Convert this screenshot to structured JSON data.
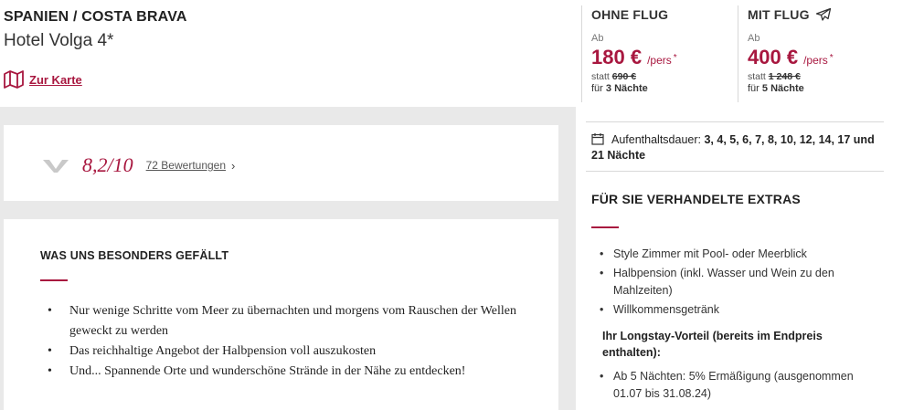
{
  "header": {
    "destination": "SPANIEN / COSTA BRAVA",
    "hotel_name": "Hotel Volga 4*",
    "map_link_label": "Zur Karte"
  },
  "rating": {
    "score": "8,2/10",
    "reviews_label": "72 Bewertungen",
    "chevron": "›"
  },
  "likes": {
    "title": "WAS UNS BESONDERS GEFÄLLT",
    "items": [
      "Nur wenige Schritte vom Meer zu übernachten und morgens vom Rauschen der Wellen geweckt zu werden",
      "Das reichhaltige Angebot der Halbpension voll auszukosten",
      "Und... Spannende Orte und wunderschöne Strände in der Nähe zu entdecken!"
    ]
  },
  "offers": {
    "ohne_flug": {
      "label": "OHNE FLUG",
      "ab": "Ab",
      "price": "180 €",
      "per": "/pers",
      "star": "*",
      "statt_prefix": "statt",
      "old_price": "690 €",
      "fuer_prefix": "für",
      "nights": "3 Nächte"
    },
    "mit_flug": {
      "label": "MIT FLUG",
      "icon": "plane-icon",
      "ab": "Ab",
      "price": "400 €",
      "per": "/pers",
      "star": "*",
      "statt_prefix": "statt",
      "old_price": "1 248 €",
      "fuer_prefix": "für",
      "nights": "5 Nächte"
    }
  },
  "stay": {
    "label": "Aufenthaltsdauer:",
    "values": "3, 4, 5, 6, 7, 8, 10, 12, 14, 17 und 21 Nächte"
  },
  "extras": {
    "title": "FÜR SIE VERHANDELTE EXTRAS",
    "items": [
      "Style Zimmer mit Pool- oder Meerblick",
      "Halbpension (inkl. Wasser und Wein zu den Mahlzeiten)",
      "Willkommensgetränk"
    ],
    "longstay_title": "Ihr Longstay-Vorteil (bereits im Endpreis enthalten):",
    "longstay_items": [
      "Ab 5 Nächten: 5% Ermäßigung (ausgenommen 01.07 bis 31.08.24)"
    ]
  },
  "colors": {
    "accent": "#a8173f",
    "grey_bg": "#e9e9e9"
  }
}
